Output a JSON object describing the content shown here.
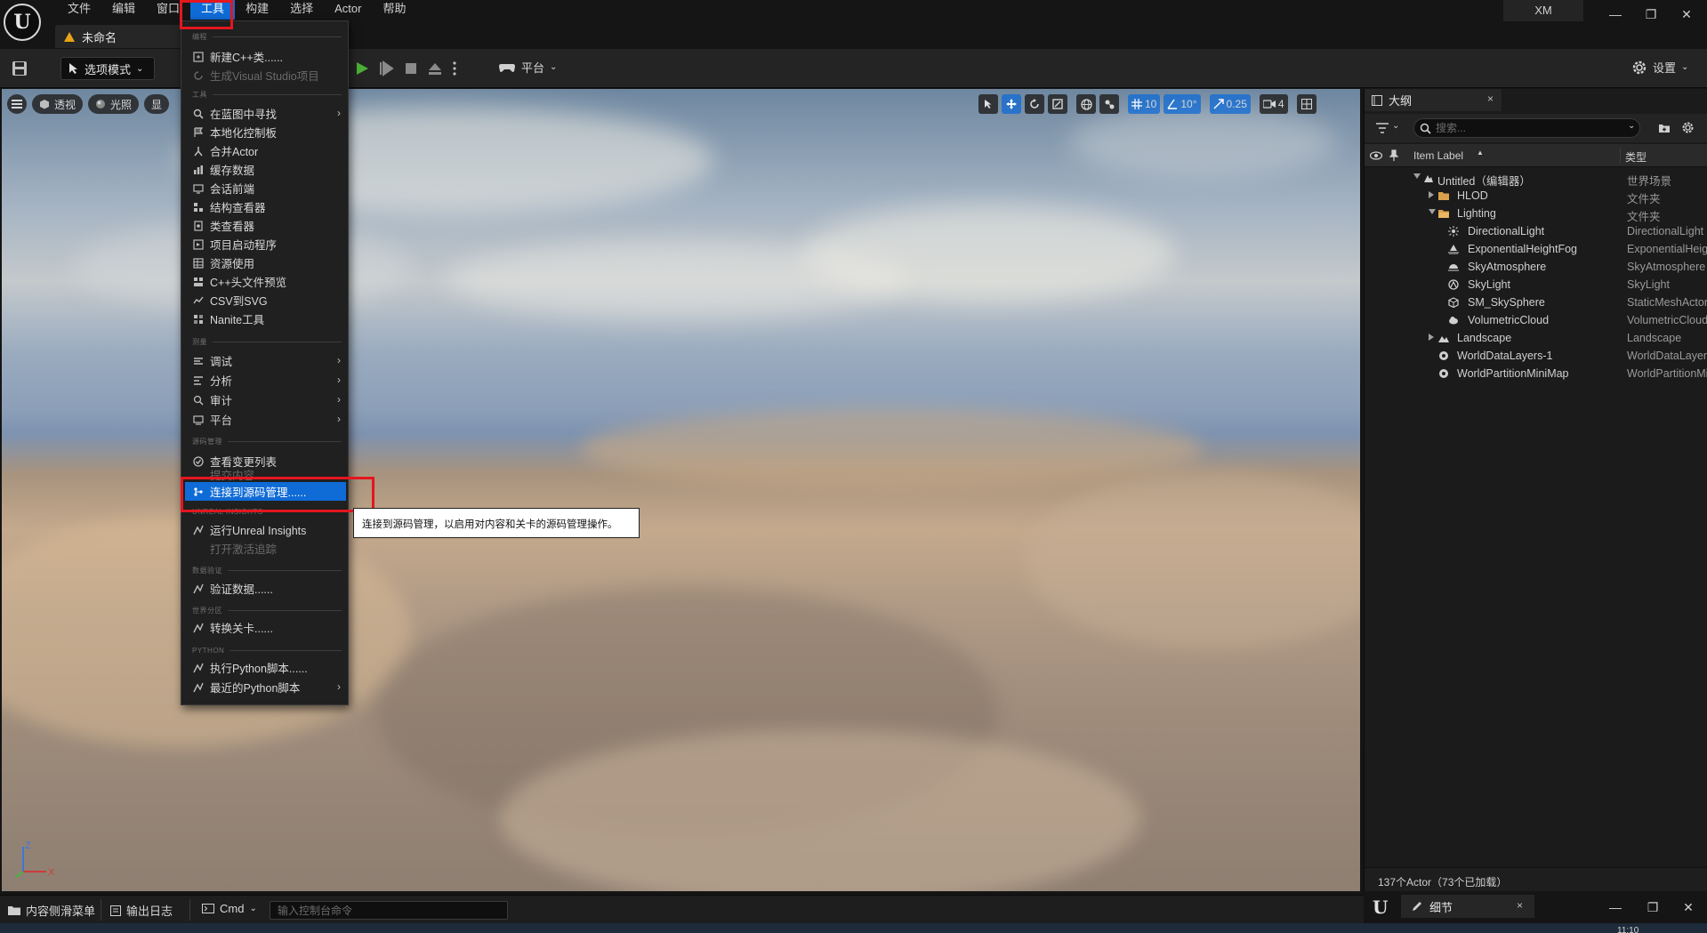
{
  "app": {
    "logo_text": "U",
    "document_tab": "未命名",
    "user": "XM",
    "window_controls": [
      "—",
      "❐",
      "✕"
    ]
  },
  "menubar": {
    "items": [
      "文件",
      "编辑",
      "窗口",
      "工具",
      "构建",
      "选择",
      "Actor",
      "帮助"
    ],
    "active": "工具"
  },
  "toolbar": {
    "mode_label": "选项模式",
    "platform_label": "平台",
    "settings_label": "设置"
  },
  "viewport": {
    "perspective_label": "透视",
    "lighting_label": "光照",
    "show_label": "显",
    "grid_snap": "10",
    "rotation_snap": "10°",
    "scale_snap": "0.25",
    "camera_speed": "4",
    "axis_z": "Z",
    "axis_x": "X"
  },
  "tools_menu": {
    "sections": {
      "programming": "编程",
      "tools": "工具",
      "profiling": "测量",
      "source_control": "源码管理",
      "insights": "UNREAL INSIGHTS",
      "data_validation": "数据验证",
      "world_partition": "世界分区",
      "python": "PYTHON"
    },
    "items": {
      "new_cpp": "新建C++类......",
      "gen_vs": "生成Visual Studio项目",
      "find_in_bp": "在蓝图中寻找",
      "localization": "本地化控制板",
      "merge_actor": "合并Actor",
      "cache_data": "缓存数据",
      "session_frontend": "会话前端",
      "struct_viewer": "结构查看器",
      "class_viewer": "类查看器",
      "project_launcher": "项目启动程序",
      "asset_usage": "资源使用",
      "cpp_header": "C++头文件预览",
      "csv_svg": "CSV到SVG",
      "nanite": "Nanite工具",
      "debug": "调试",
      "analyze": "分析",
      "audit": "审计",
      "platform": "平台",
      "view_changelists": "查看变更列表",
      "submit_content": "提交内容",
      "connect_sc": "连接到源码管理......",
      "run_insights": "运行Unreal Insights",
      "open_trace": "打开激活追踪",
      "validate_data": "验证数据......",
      "convert_level": "转换关卡......",
      "exec_python": "执行Python脚本......",
      "recent_python": "最近的Python脚本"
    },
    "tooltip": "连接到源码管理，以启用对内容和关卡的源码管理操作。"
  },
  "outliner": {
    "tab_label": "大纲",
    "close": "×",
    "search_placeholder": "搜索...",
    "col_label": "Item Label",
    "col_type": "类型",
    "rows": [
      {
        "label": "Untitled（编辑器）",
        "type": "世界场景"
      },
      {
        "label": "HLOD",
        "type": "文件夹"
      },
      {
        "label": "Lighting",
        "type": "文件夹"
      },
      {
        "label": "DirectionalLight",
        "type": "DirectionalLight"
      },
      {
        "label": "ExponentialHeightFog",
        "type": "ExponentialHeightFog"
      },
      {
        "label": "SkyAtmosphere",
        "type": "SkyAtmosphere"
      },
      {
        "label": "SkyLight",
        "type": "SkyLight"
      },
      {
        "label": "SM_SkySphere",
        "type": "StaticMeshActor"
      },
      {
        "label": "VolumetricCloud",
        "type": "VolumetricCloud"
      },
      {
        "label": "Landscape",
        "type": "Landscape"
      },
      {
        "label": "WorldDataLayers-1",
        "type": "WorldDataLayers"
      },
      {
        "label": "WorldPartitionMiniMap",
        "type": "WorldPartitionMiniMap"
      }
    ],
    "footer": "137个Actor（73个已加载）"
  },
  "details": {
    "tab_label": "细节",
    "close": "×"
  },
  "statusbar": {
    "content_drawer": "内容侧滑菜单",
    "output_log": "输出日志",
    "cmd": "Cmd",
    "console_placeholder": "输入控制台命令"
  },
  "taskbar": {
    "clock": "11:10"
  },
  "colors": {
    "accent": "#0f6bd6",
    "highlight_box": "#e4161e",
    "panel": "#1b1b1b",
    "warning": "#e8a317"
  }
}
